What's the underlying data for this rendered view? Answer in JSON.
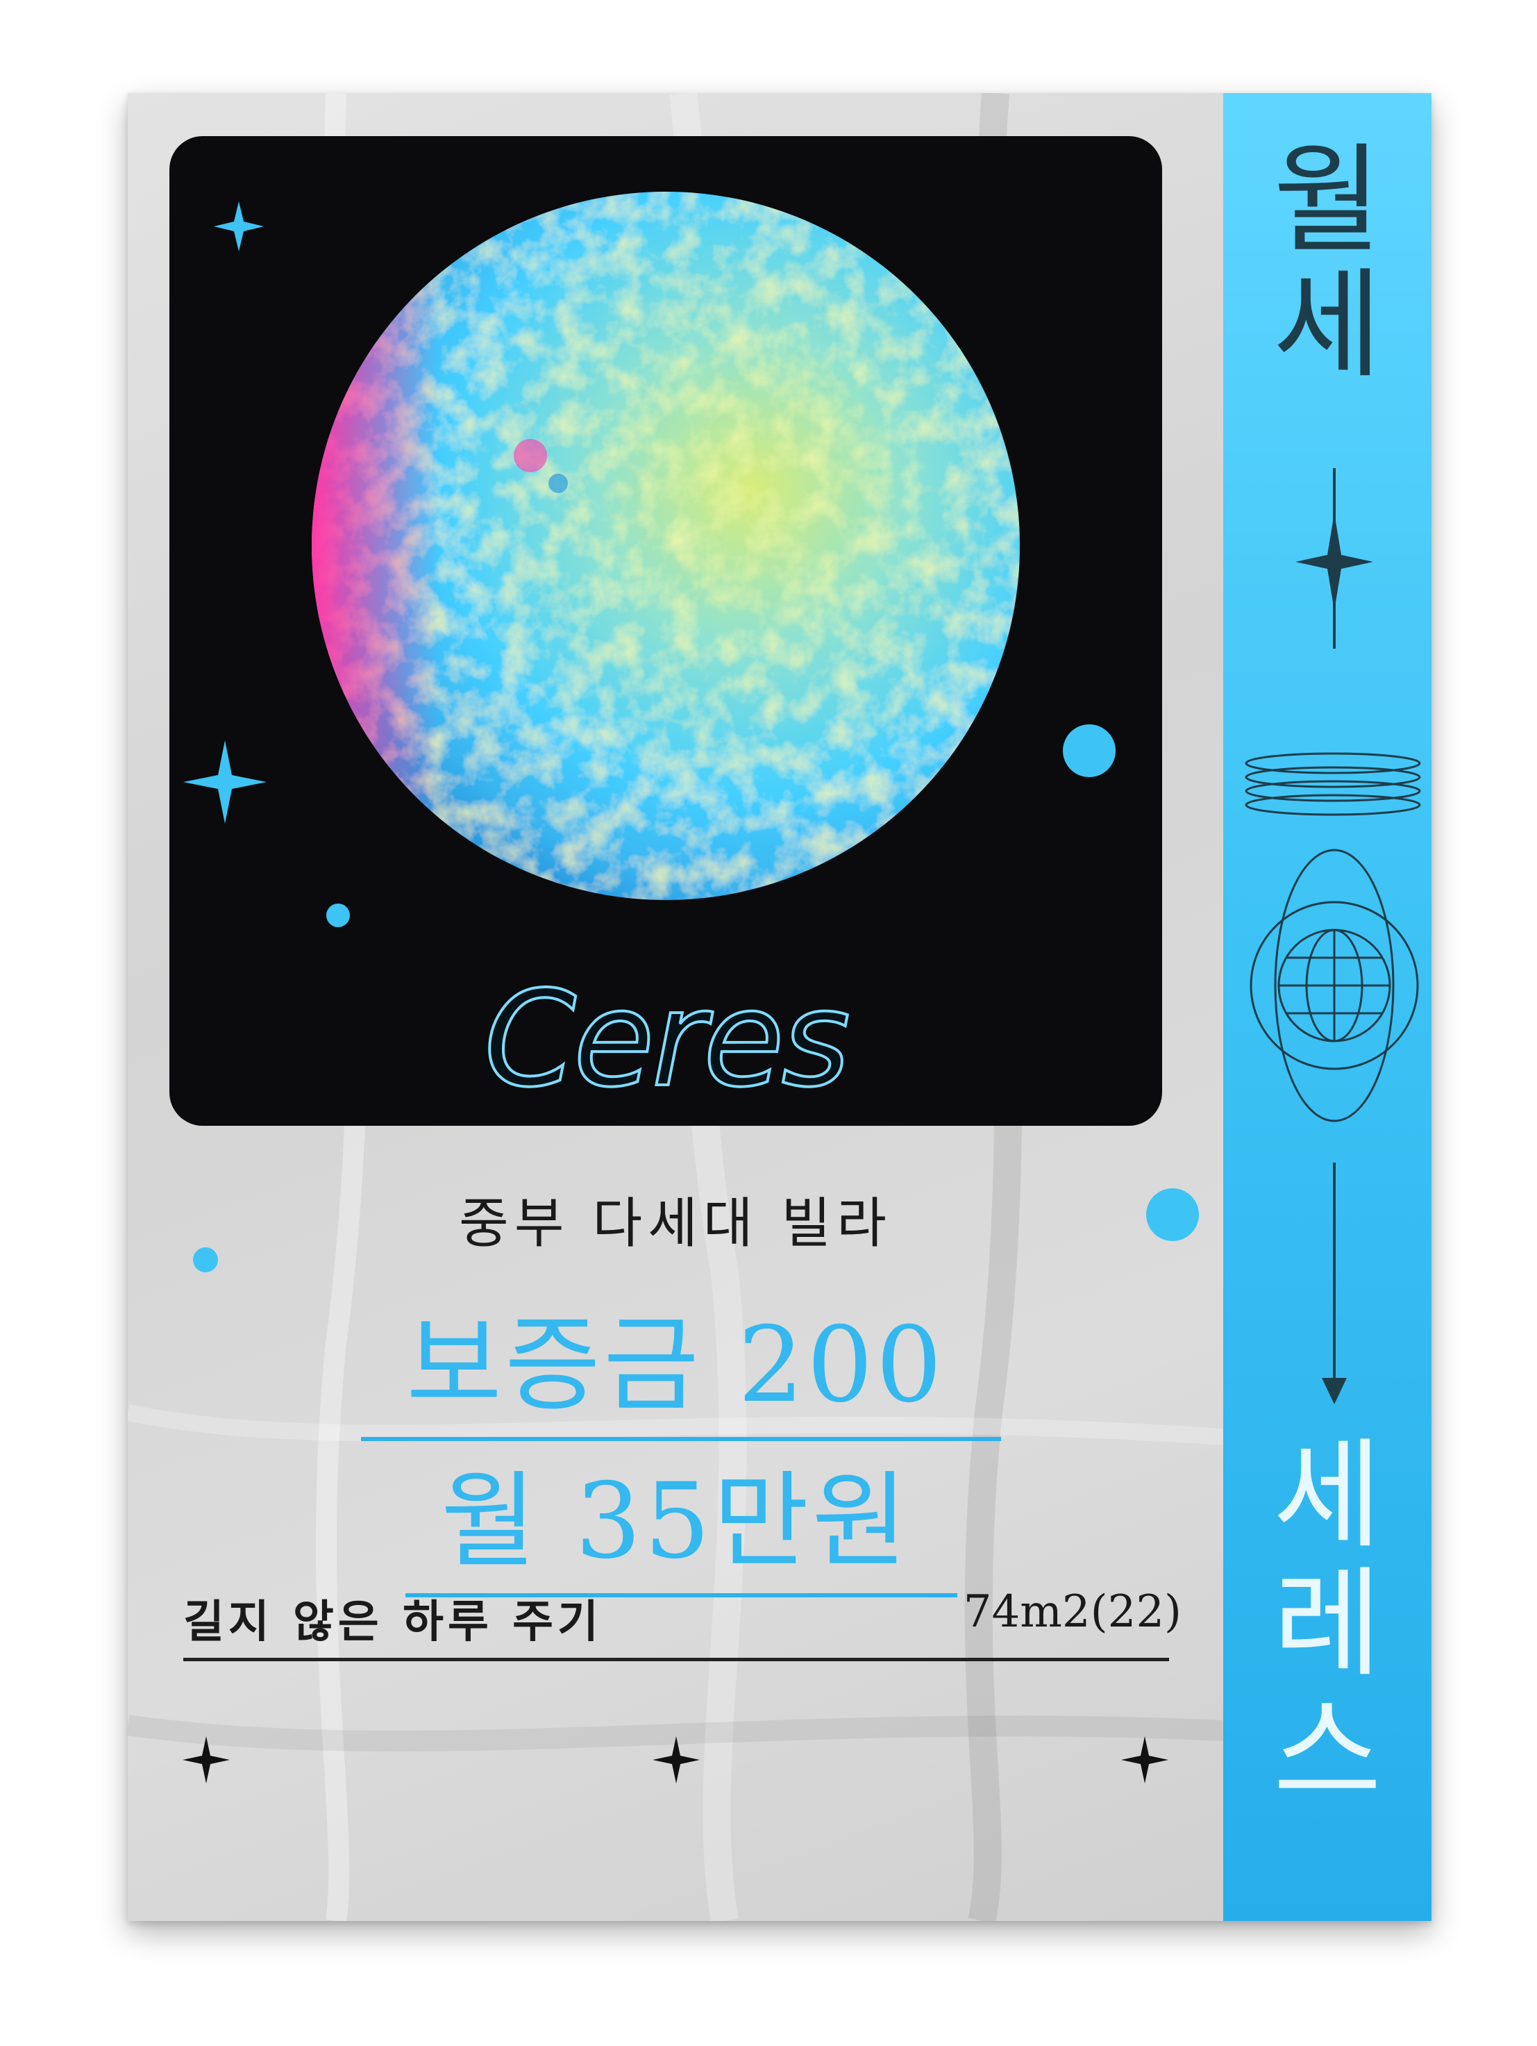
{
  "poster": {
    "name": "Ceres",
    "subtitle": "중부 다세대 빌라",
    "deposit": "보증금 200",
    "monthly_rent": "월 35만원",
    "footer_left": "길지 않은 하루 주기",
    "footer_right": "74m2(22)"
  },
  "sidebar": {
    "top_text": [
      "월",
      "세"
    ],
    "bottom_text": [
      "세",
      "레",
      "스"
    ]
  },
  "colors": {
    "accent": "#34b8ef",
    "sidebar": "#3ec3f5",
    "photo_bg": "#0b0b0d",
    "planet_pink": "#ff3aa8",
    "planet_cyan": "#47d3ff",
    "planet_yellow": "#e8ec6a"
  },
  "icons": [
    "sparkle-icon",
    "dot-icon",
    "rings-icon",
    "globe-orbit-icon",
    "arrow-down-icon"
  ]
}
